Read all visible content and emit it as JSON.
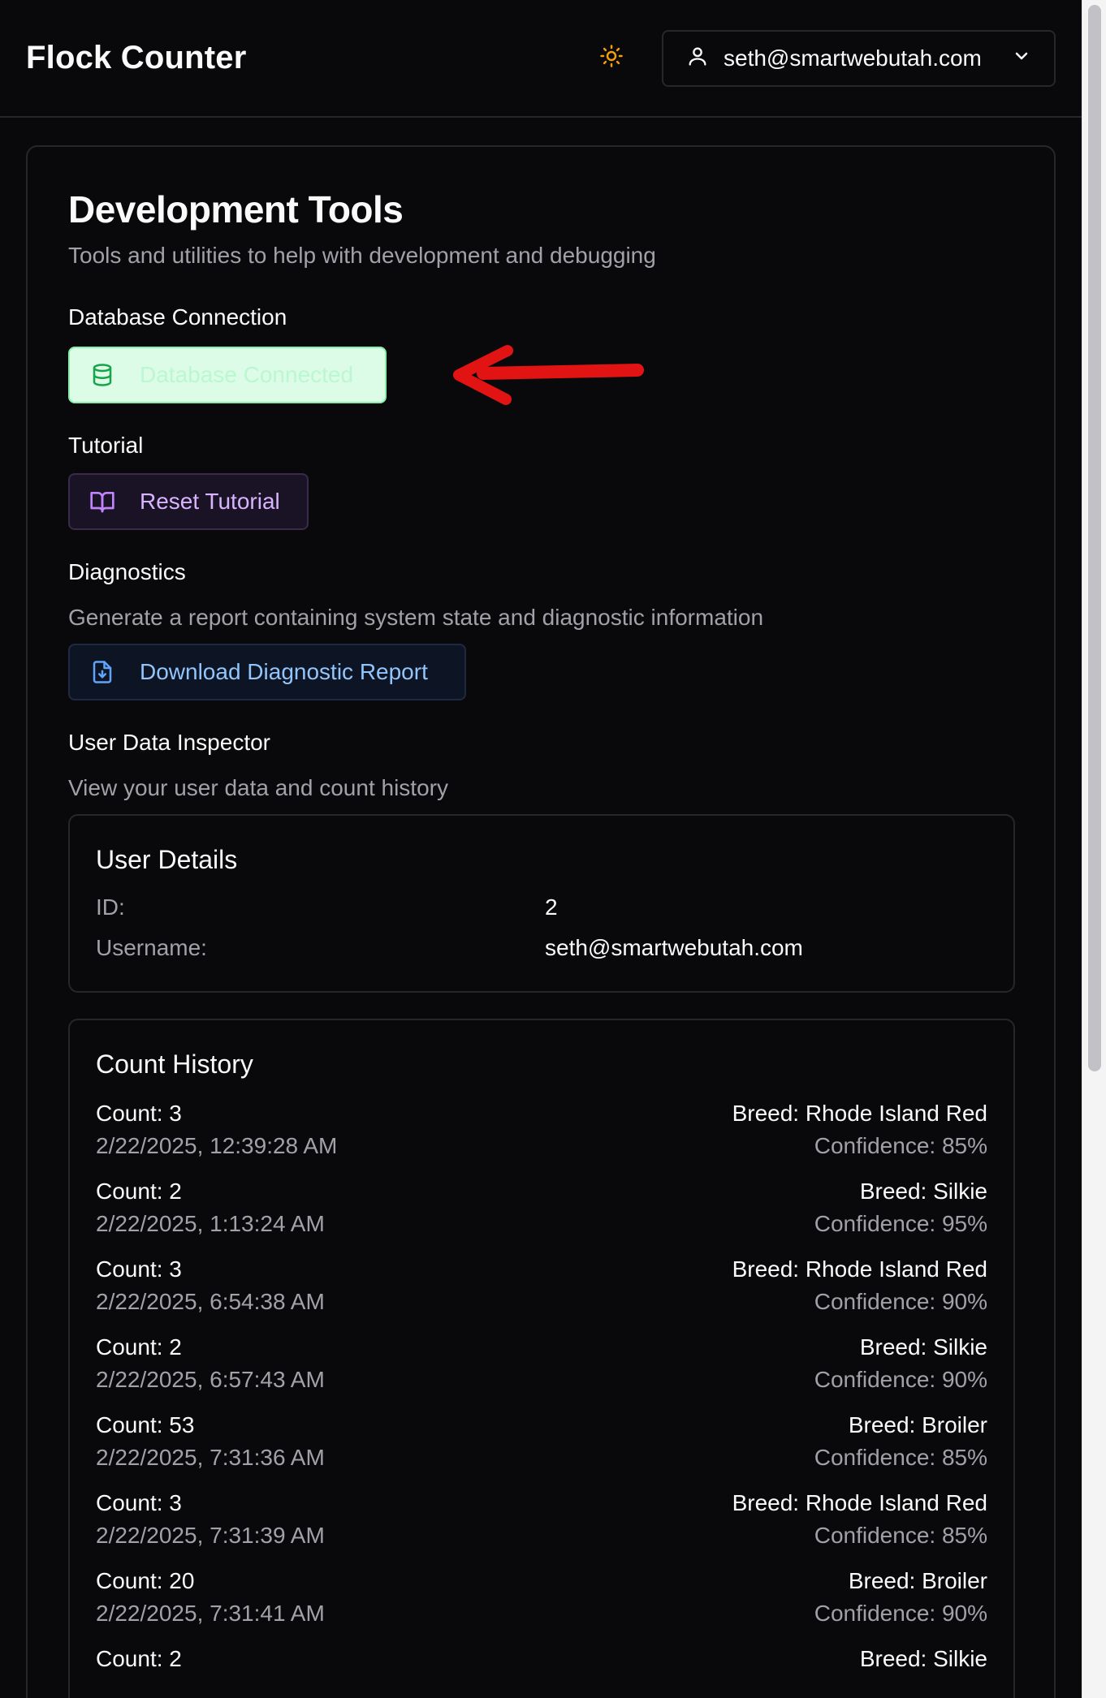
{
  "header": {
    "brand": "Flock Counter",
    "theme_icon": "sun-icon",
    "user_email": "seth@smartwebutah.com",
    "user_icon": "user-icon",
    "chevron_icon": "chevron-down-icon"
  },
  "page": {
    "title": "Development Tools",
    "subtitle": "Tools and utilities to help with development and debugging"
  },
  "database": {
    "label": "Database Connection",
    "button_label": "Database Connected",
    "icon": "database-icon",
    "accent": "#22c55e"
  },
  "tutorial": {
    "label": "Tutorial",
    "button_label": "Reset Tutorial",
    "icon": "book-open-icon",
    "accent": "#c084fc"
  },
  "diagnostics": {
    "label": "Diagnostics",
    "description": "Generate a report containing system state and diagnostic information",
    "button_label": "Download Diagnostic Report",
    "icon": "file-download-icon",
    "accent": "#60a5fa"
  },
  "inspector": {
    "label": "User Data Inspector",
    "description": "View your user data and count history",
    "user_details": {
      "title": "User Details",
      "rows": [
        {
          "key": "ID:",
          "value": "2"
        },
        {
          "key": "Username:",
          "value": "seth@smartwebutah.com"
        }
      ]
    },
    "count_history": {
      "title": "Count History",
      "rows": [
        {
          "count": "Count: 3",
          "time": "2/22/2025, 12:39:28 AM",
          "breed": "Breed: Rhode Island Red",
          "confidence": "Confidence: 85%"
        },
        {
          "count": "Count: 2",
          "time": "2/22/2025, 1:13:24 AM",
          "breed": "Breed: Silkie",
          "confidence": "Confidence: 95%"
        },
        {
          "count": "Count: 3",
          "time": "2/22/2025, 6:54:38 AM",
          "breed": "Breed: Rhode Island Red",
          "confidence": "Confidence: 90%"
        },
        {
          "count": "Count: 2",
          "time": "2/22/2025, 6:57:43 AM",
          "breed": "Breed: Silkie",
          "confidence": "Confidence: 90%"
        },
        {
          "count": "Count: 53",
          "time": "2/22/2025, 7:31:36 AM",
          "breed": "Breed: Broiler",
          "confidence": "Confidence: 85%"
        },
        {
          "count": "Count: 3",
          "time": "2/22/2025, 7:31:39 AM",
          "breed": "Breed: Rhode Island Red",
          "confidence": "Confidence: 85%"
        },
        {
          "count": "Count: 20",
          "time": "2/22/2025, 7:31:41 AM",
          "breed": "Breed: Broiler",
          "confidence": "Confidence: 90%"
        },
        {
          "count": "Count: 2",
          "time": "",
          "breed": "Breed: Silkie",
          "confidence": ""
        }
      ]
    }
  },
  "annotation": {
    "arrow_color": "#e11313"
  }
}
